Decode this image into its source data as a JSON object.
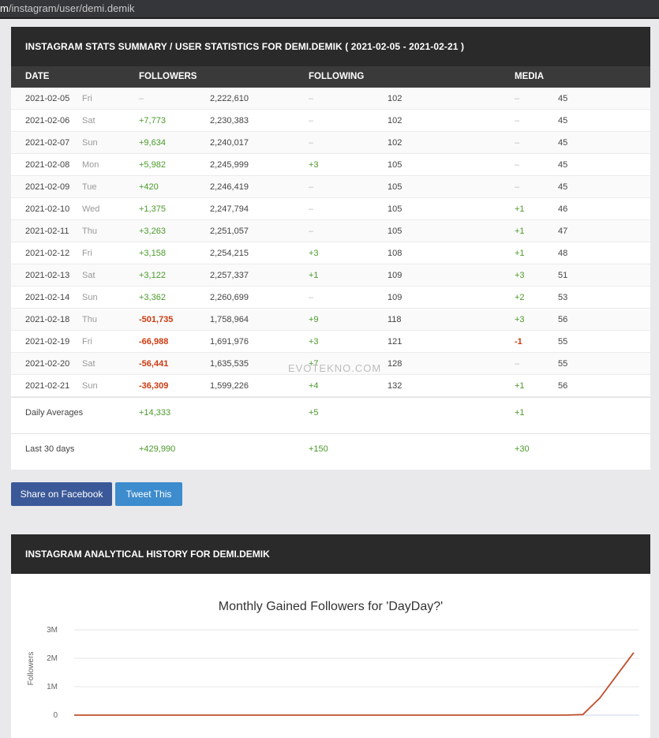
{
  "browser": {
    "url_prefix": "m",
    "url_path": "/instagram/user/demi.demik"
  },
  "summary": {
    "title": "INSTAGRAM STATS SUMMARY / USER STATISTICS FOR DEMI.DEMIK ( 2021-02-05 - 2021-02-21 )",
    "columns": {
      "date": "DATE",
      "followers": "FOLLOWERS",
      "following": "FOLLOWING",
      "media": "MEDIA"
    },
    "rows": [
      {
        "date": "2021-02-05",
        "day": "Fri",
        "followers_change": "–",
        "followers": "2,222,610",
        "following_change": "–",
        "following": "102",
        "media_change": "–",
        "media": "45"
      },
      {
        "date": "2021-02-06",
        "day": "Sat",
        "followers_change": "+7,773",
        "followers": "2,230,383",
        "following_change": "–",
        "following": "102",
        "media_change": "–",
        "media": "45"
      },
      {
        "date": "2021-02-07",
        "day": "Sun",
        "followers_change": "+9,634",
        "followers": "2,240,017",
        "following_change": "–",
        "following": "102",
        "media_change": "–",
        "media": "45"
      },
      {
        "date": "2021-02-08",
        "day": "Mon",
        "followers_change": "+5,982",
        "followers": "2,245,999",
        "following_change": "+3",
        "following": "105",
        "media_change": "–",
        "media": "45"
      },
      {
        "date": "2021-02-09",
        "day": "Tue",
        "followers_change": "+420",
        "followers": "2,246,419",
        "following_change": "–",
        "following": "105",
        "media_change": "–",
        "media": "45"
      },
      {
        "date": "2021-02-10",
        "day": "Wed",
        "followers_change": "+1,375",
        "followers": "2,247,794",
        "following_change": "–",
        "following": "105",
        "media_change": "+1",
        "media": "46"
      },
      {
        "date": "2021-02-11",
        "day": "Thu",
        "followers_change": "+3,263",
        "followers": "2,251,057",
        "following_change": "–",
        "following": "105",
        "media_change": "+1",
        "media": "47"
      },
      {
        "date": "2021-02-12",
        "day": "Fri",
        "followers_change": "+3,158",
        "followers": "2,254,215",
        "following_change": "+3",
        "following": "108",
        "media_change": "+1",
        "media": "48"
      },
      {
        "date": "2021-02-13",
        "day": "Sat",
        "followers_change": "+3,122",
        "followers": "2,257,337",
        "following_change": "+1",
        "following": "109",
        "media_change": "+3",
        "media": "51"
      },
      {
        "date": "2021-02-14",
        "day": "Sun",
        "followers_change": "+3,362",
        "followers": "2,260,699",
        "following_change": "–",
        "following": "109",
        "media_change": "+2",
        "media": "53"
      },
      {
        "date": "2021-02-18",
        "day": "Thu",
        "followers_change": "-501,735",
        "followers": "1,758,964",
        "following_change": "+9",
        "following": "118",
        "media_change": "+3",
        "media": "56"
      },
      {
        "date": "2021-02-19",
        "day": "Fri",
        "followers_change": "-66,988",
        "followers": "1,691,976",
        "following_change": "+3",
        "following": "121",
        "media_change": "-1",
        "media": "55"
      },
      {
        "date": "2021-02-20",
        "day": "Sat",
        "followers_change": "-56,441",
        "followers": "1,635,535",
        "following_change": "+7",
        "following": "128",
        "media_change": "–",
        "media": "55"
      },
      {
        "date": "2021-02-21",
        "day": "Sun",
        "followers_change": "-36,309",
        "followers": "1,599,226",
        "following_change": "+4",
        "following": "132",
        "media_change": "+1",
        "media": "56"
      }
    ],
    "daily_averages": {
      "label": "Daily Averages",
      "followers": "+14,333",
      "following": "+5",
      "media": "+1"
    },
    "last_30_days": {
      "label": "Last 30 days",
      "followers": "+429,990",
      "following": "+150",
      "media": "+30"
    },
    "watermark": "EVOTEKNO.COM"
  },
  "share": {
    "facebook_label": "Share on Facebook",
    "twitter_label": "Tweet This"
  },
  "history": {
    "title": "INSTAGRAM ANALYTICAL HISTORY FOR DEMI.DEMIK",
    "chart_data": {
      "type": "line",
      "title": "Monthly Gained Followers for 'DayDay?'",
      "ylabel": "Followers",
      "xlabel": "",
      "yticks": [
        "0",
        "1M",
        "2M",
        "3M"
      ],
      "ylim": [
        0,
        3000000
      ],
      "grid": true,
      "series_color": "#c0502e",
      "series": [
        {
          "values": [
            0,
            0,
            0,
            0,
            0,
            0,
            0,
            0,
            0,
            0,
            0,
            0,
            0,
            0,
            0,
            0,
            0,
            0,
            0,
            0,
            0,
            0,
            0,
            0,
            0,
            0,
            0,
            0,
            0,
            0,
            20000,
            600000,
            1400000,
            2200000
          ]
        }
      ]
    }
  }
}
